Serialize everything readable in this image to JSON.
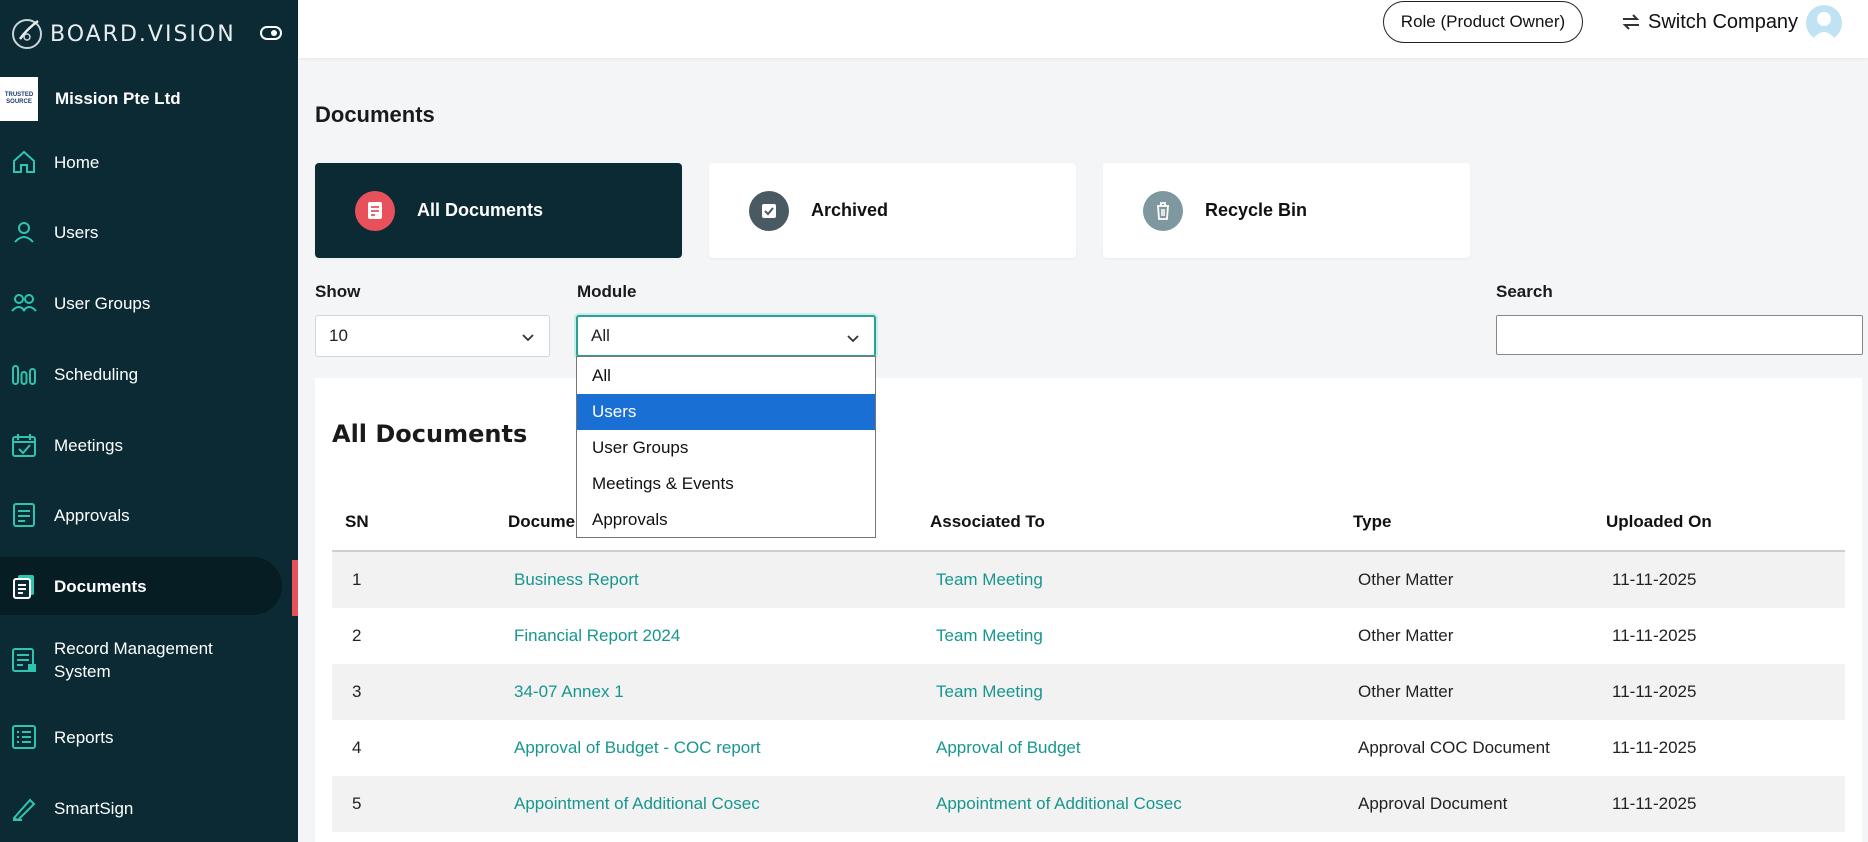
{
  "brand": {
    "name": "BOARD.VISION"
  },
  "company": {
    "name": "Mission Pte Ltd",
    "logo_text": [
      "TRUSTED",
      "SOURCE"
    ]
  },
  "sidebar": {
    "items": [
      {
        "label": "Home",
        "icon": "home-icon"
      },
      {
        "label": "Users",
        "icon": "user-icon"
      },
      {
        "label": "User Groups",
        "icon": "user-groups-icon"
      },
      {
        "label": "Scheduling",
        "icon": "scheduling-icon"
      },
      {
        "label": "Meetings",
        "icon": "calendar-check-icon"
      },
      {
        "label": "Approvals",
        "icon": "approvals-icon"
      },
      {
        "label": "Documents",
        "icon": "documents-icon",
        "active": true
      },
      {
        "label": "Record Management System",
        "icon": "record-management-icon"
      },
      {
        "label": "Reports",
        "icon": "reports-icon"
      },
      {
        "label": "SmartSign",
        "icon": "signature-icon"
      }
    ]
  },
  "topbar": {
    "role_label": "Role (Product Owner)",
    "switch_company_label": "Switch Company"
  },
  "page": {
    "title": "Documents"
  },
  "tabs": [
    {
      "label": "All Documents",
      "icon": "document-icon",
      "active": true
    },
    {
      "label": "Archived",
      "icon": "archive-check-icon"
    },
    {
      "label": "Recycle Bin",
      "icon": "trash-icon"
    }
  ],
  "filters": {
    "show_label": "Show",
    "show_value": "10",
    "module_label": "Module",
    "module_value": "All",
    "module_options": [
      "All",
      "Users",
      "User Groups",
      "Meetings & Events",
      "Approvals"
    ],
    "module_highlighted": "Users",
    "search_label": "Search",
    "search_value": ""
  },
  "table": {
    "title": "All Documents",
    "columns": [
      "SN",
      "Document",
      "Associated To",
      "Type",
      "Uploaded On"
    ],
    "rows": [
      {
        "sn": "1",
        "document": "Business Report",
        "associated": "Team Meeting",
        "type": "Other Matter",
        "uploaded": "11-11-2025"
      },
      {
        "sn": "2",
        "document": "Financial Report 2024",
        "associated": "Team Meeting",
        "type": "Other Matter",
        "uploaded": "11-11-2025"
      },
      {
        "sn": "3",
        "document": "34-07 Annex 1",
        "associated": "Team Meeting",
        "type": "Other Matter",
        "uploaded": "11-11-2025"
      },
      {
        "sn": "4",
        "document": "Approval of Budget - COC report",
        "associated": "Approval of Budget",
        "type": "Approval COC Document",
        "uploaded": "11-11-2025"
      },
      {
        "sn": "5",
        "document": "Appointment of Additional Cosec",
        "associated": "Appointment of Additional Cosec",
        "type": "Approval Document",
        "uploaded": "11-11-2025"
      }
    ]
  },
  "colors": {
    "sidebar_bg": "#0b2a33",
    "accent_teal": "#17968f",
    "active_marker": "#e8505b",
    "dropdown_highlight": "#1a6fd4"
  }
}
